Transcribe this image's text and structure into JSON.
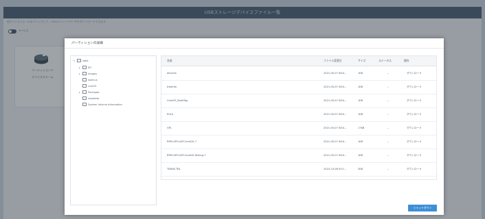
{
  "window": {
    "title": "USBストレージデバイスファイル一覧",
    "hint": "他デバイスフォームをクリックして、USBストレージデータをダウンロードできます",
    "toggle_label": "サービス"
  },
  "device": {
    "label1": "パーティションド",
    "label2": "デバイスステーム"
  },
  "modal": {
    "title": "パーティションの詳細",
    "tree": [
      {
        "label": "sdb4",
        "depth": 0,
        "caret": "▾"
      },
      {
        "label": "EFI",
        "depth": 1,
        "caret": "▸"
      },
      {
        "label": "images",
        "depth": 1,
        "caret": "▸"
      },
      {
        "label": "isolinux",
        "depth": 1,
        "caret": ""
      },
      {
        "label": "LiveOS",
        "depth": 1,
        "caret": ""
      },
      {
        "label": "Packages",
        "depth": 1,
        "caret": "▸"
      },
      {
        "label": "repodata",
        "depth": 1,
        "caret": ""
      },
      {
        "label": "System Volume Information",
        "depth": 1,
        "caret": ""
      }
    ],
    "columns": {
      "name": "名前",
      "date": "ファイル変更日",
      "size": "サイズ",
      "status": "ステータス",
      "action": "操作"
    },
    "rows": [
      {
        "name": "discinfo",
        "date": "2021-05-07 08:0...",
        "size": "1KB",
        "status": "--",
        "action": "ダウンロード"
      },
      {
        "name": "treeinfo",
        "date": "2021-05-07 08:0...",
        "size": "1KB",
        "status": "--",
        "action": "ダウンロード"
      },
      {
        "name": "CentOS_BuildTag",
        "date": "2021-05-07 08:0...",
        "size": "1KB",
        "status": "--",
        "action": "ダウンロード"
      },
      {
        "name": "EULA",
        "date": "2021-05-07 08:0...",
        "size": "1KB",
        "status": "--",
        "action": "ダウンロード"
      },
      {
        "name": "GPL",
        "date": "2021-05-07 08:0...",
        "size": "17KB",
        "status": "--",
        "action": "ダウンロード"
      },
      {
        "name": "RPM-GPG-KEY-CentOS-7",
        "date": "2021-05-07 08:0...",
        "size": "1KB",
        "status": "--",
        "action": "ダウンロード"
      },
      {
        "name": "RPM-GPG-KEY-CentOS-Testing-7",
        "date": "2021-05-07 08:0...",
        "size": "1KB",
        "status": "--",
        "action": "ダウンロード"
      },
      {
        "name": "TRANS.TBL",
        "date": "2023-10-08 05:1...",
        "size": "2KB",
        "status": "--",
        "action": "ダウンロード"
      }
    ],
    "shutdown_label": "シャットダウン"
  }
}
